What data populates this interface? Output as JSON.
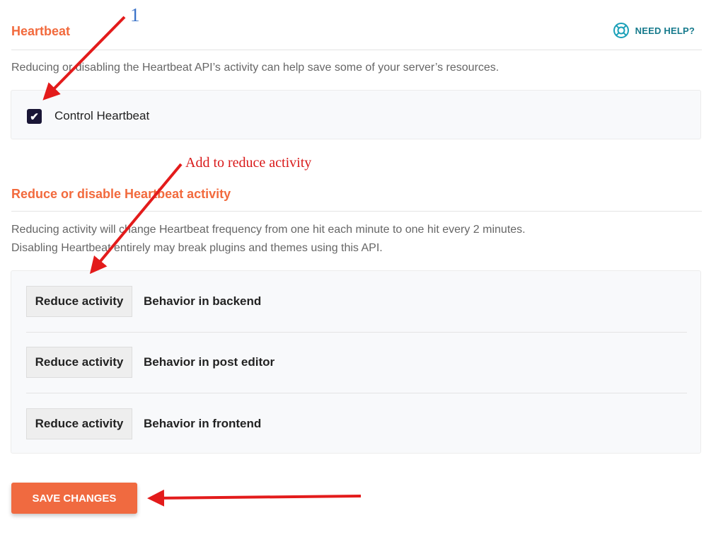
{
  "heartbeat": {
    "title": "Heartbeat",
    "help_label": "NEED HELP?",
    "description": "Reducing or disabling the Heartbeat API’s activity can help save some of your server’s resources.",
    "control_label": "Control Heartbeat",
    "control_checked": true
  },
  "reduce": {
    "title": "Reduce or disable Heartbeat activity",
    "description_line1": "Reducing activity will change Heartbeat frequency from one hit each minute to one hit every 2 minutes.",
    "description_line2": "Disabling Heartbeat entirely may break plugins and themes using this API.",
    "rows": [
      {
        "value": "Reduce activity",
        "label": "Behavior in backend"
      },
      {
        "value": "Reduce activity",
        "label": "Behavior in post editor"
      },
      {
        "value": "Reduce activity",
        "label": "Behavior in frontend"
      }
    ]
  },
  "save_label": "SAVE CHANGES",
  "annotations": {
    "step_number": "1",
    "note": "Add to reduce activity",
    "color_arrow": "#e31b1b",
    "color_number": "#3a72c8"
  },
  "colors": {
    "accent": "#f26a3d",
    "help": "#167a8c",
    "checkbox": "#1a1636"
  }
}
